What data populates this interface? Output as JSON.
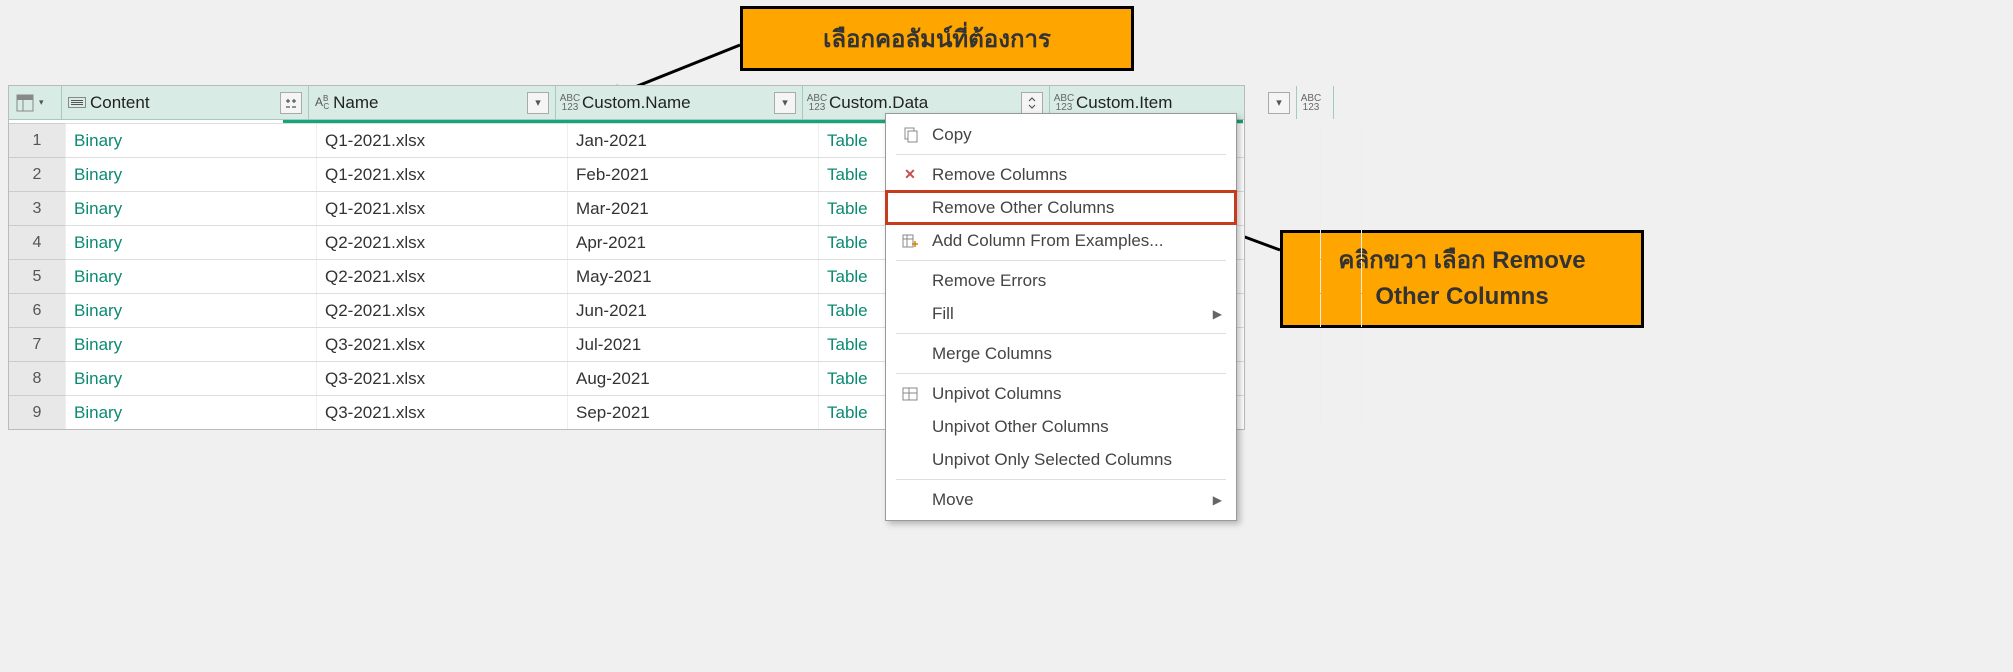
{
  "callouts": {
    "top": "เลือกคอลัมน์ที่ต้องการ",
    "right_line1": "คลิกขวา เลือก Remove",
    "right_line2": "Other Columns"
  },
  "columns": {
    "content": "Content",
    "name": "Name",
    "custom_name": "Custom.Name",
    "custom_data": "Custom.Data",
    "custom_item": "Custom.Item"
  },
  "rows": [
    {
      "n": "1",
      "content": "Binary",
      "name": "Q1-2021.xlsx",
      "cname": "Jan-2021",
      "cdata": "Table"
    },
    {
      "n": "2",
      "content": "Binary",
      "name": "Q1-2021.xlsx",
      "cname": "Feb-2021",
      "cdata": "Table"
    },
    {
      "n": "3",
      "content": "Binary",
      "name": "Q1-2021.xlsx",
      "cname": "Mar-2021",
      "cdata": "Table"
    },
    {
      "n": "4",
      "content": "Binary",
      "name": "Q2-2021.xlsx",
      "cname": "Apr-2021",
      "cdata": "Table"
    },
    {
      "n": "5",
      "content": "Binary",
      "name": "Q2-2021.xlsx",
      "cname": "May-2021",
      "cdata": "Table"
    },
    {
      "n": "6",
      "content": "Binary",
      "name": "Q2-2021.xlsx",
      "cname": "Jun-2021",
      "cdata": "Table"
    },
    {
      "n": "7",
      "content": "Binary",
      "name": "Q3-2021.xlsx",
      "cname": "Jul-2021",
      "cdata": "Table"
    },
    {
      "n": "8",
      "content": "Binary",
      "name": "Q3-2021.xlsx",
      "cname": "Aug-2021",
      "cdata": "Table"
    },
    {
      "n": "9",
      "content": "Binary",
      "name": "Q3-2021.xlsx",
      "cname": "Sep-2021",
      "cdata": "Table"
    }
  ],
  "menu": {
    "copy": "Copy",
    "remove_columns": "Remove Columns",
    "remove_other_columns": "Remove Other Columns",
    "add_column_from_examples": "Add Column From Examples...",
    "remove_errors": "Remove Errors",
    "fill": "Fill",
    "merge_columns": "Merge Columns",
    "unpivot_columns": "Unpivot Columns",
    "unpivot_other_columns": "Unpivot Other Columns",
    "unpivot_only_selected": "Unpivot Only Selected Columns",
    "move": "Move"
  }
}
